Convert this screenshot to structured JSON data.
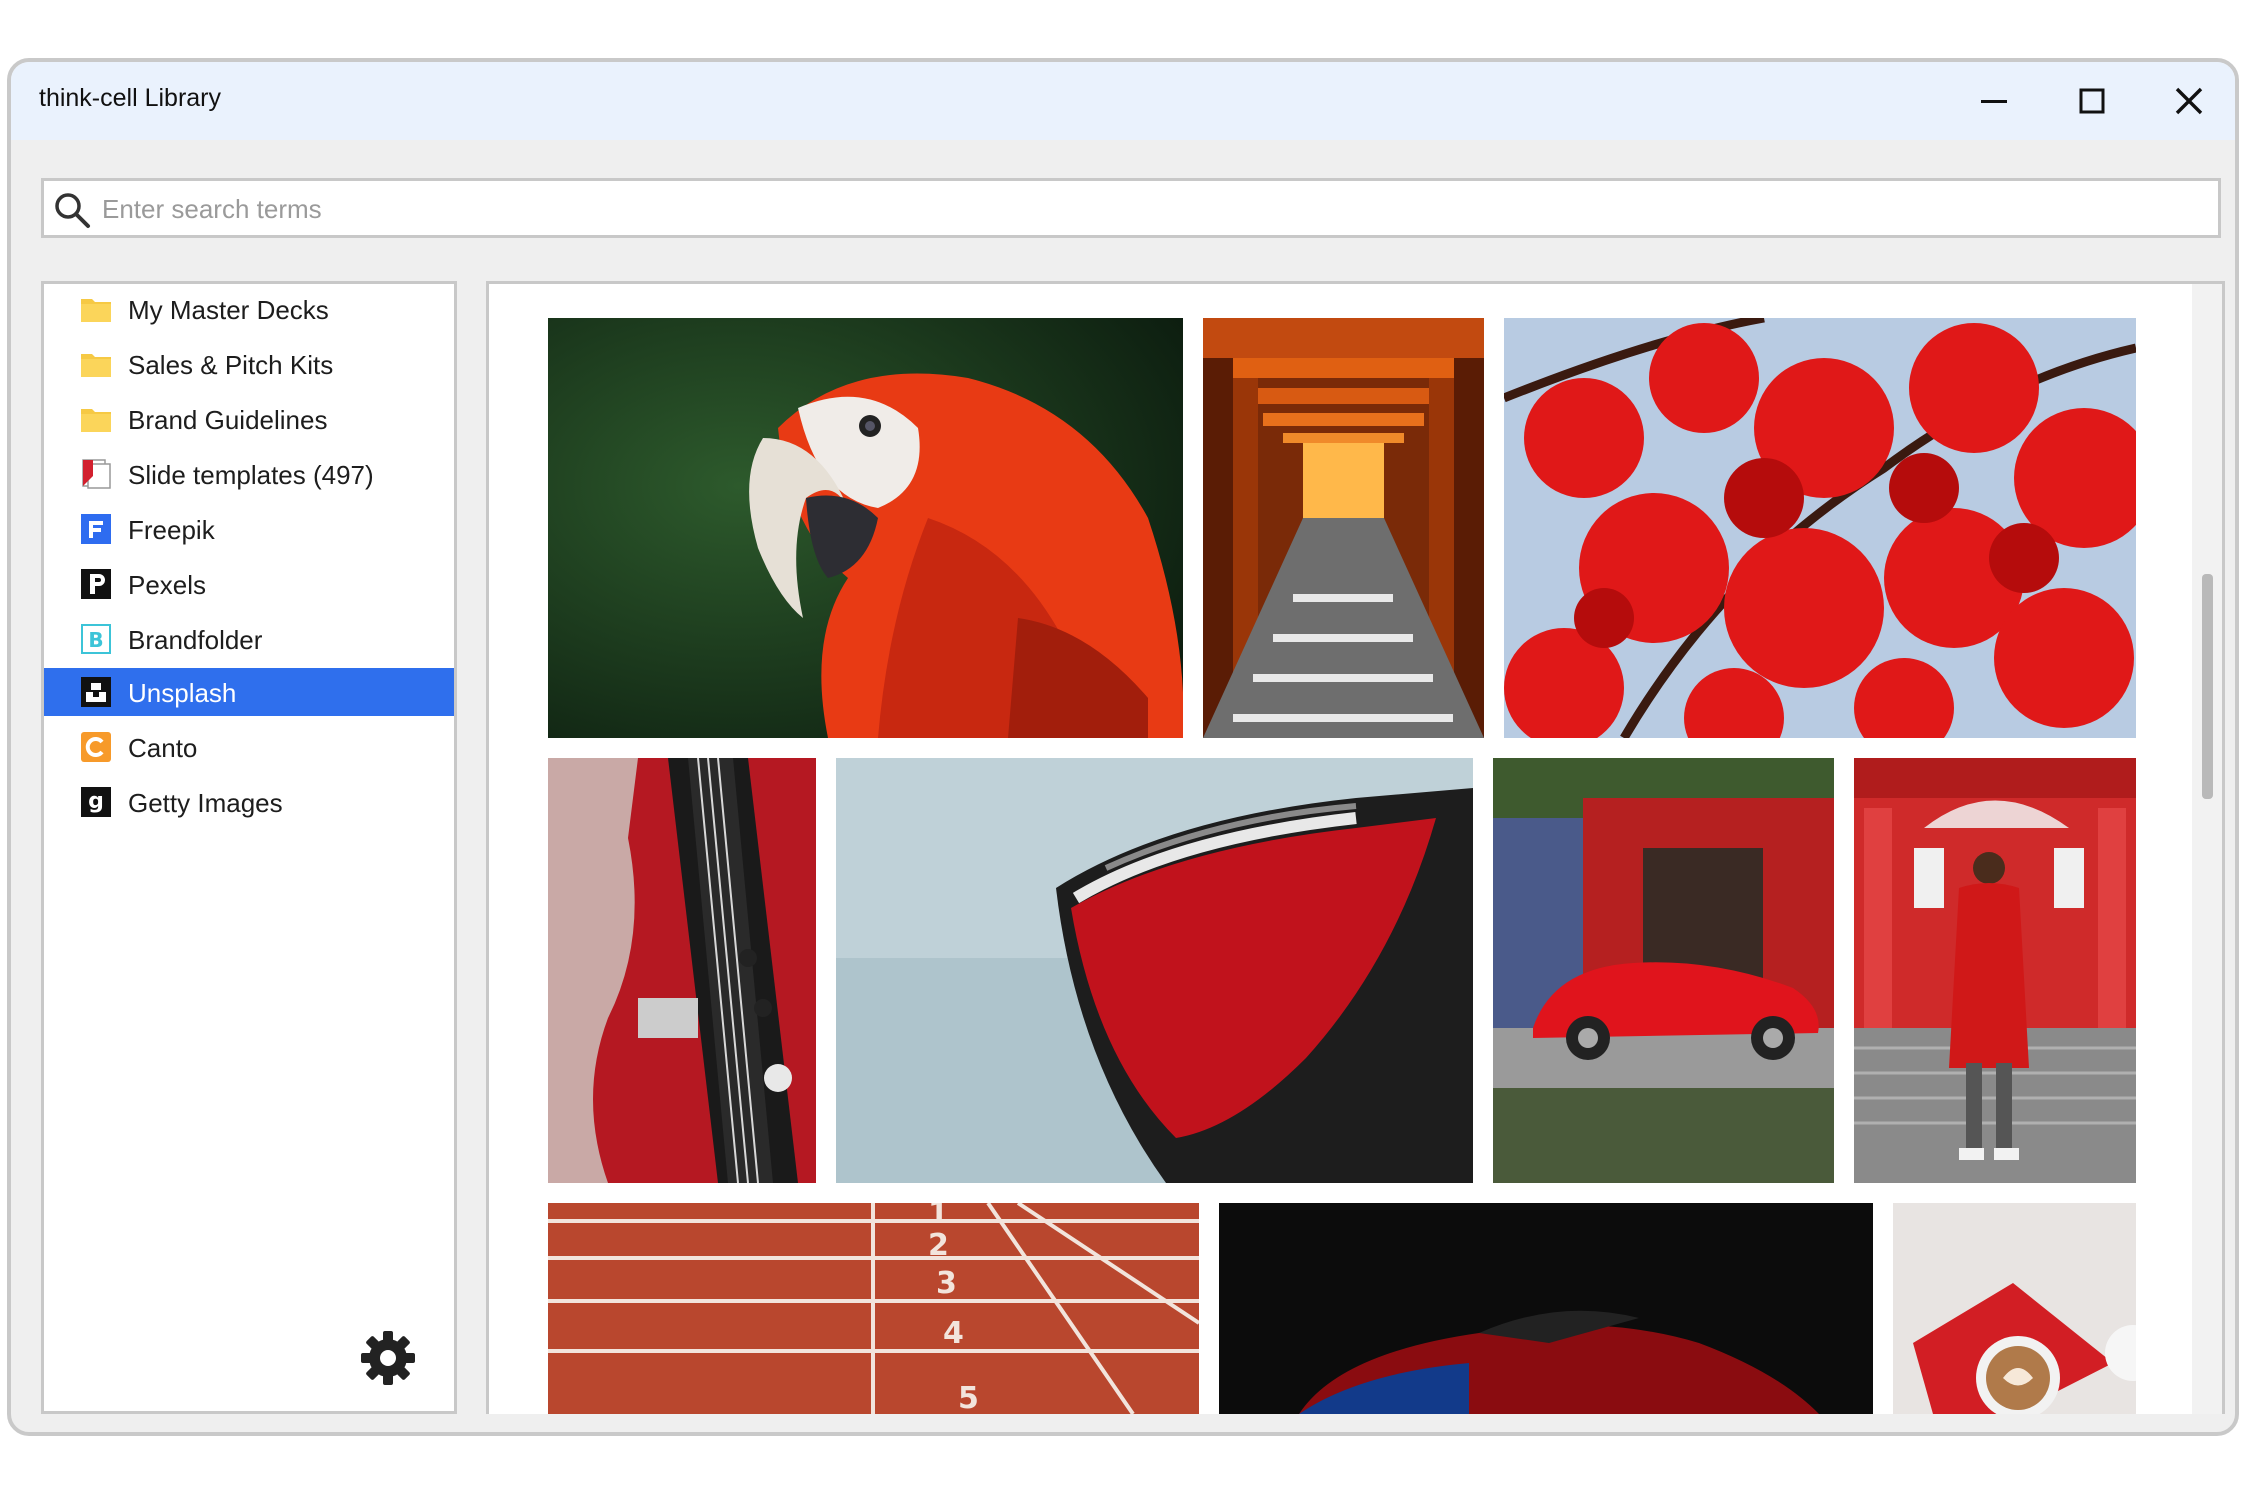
{
  "window": {
    "title": "think-cell Library",
    "minimize_icon": "minimize-icon",
    "maximize_icon": "maximize-icon",
    "close_icon": "close-icon"
  },
  "search": {
    "placeholder": "Enter search terms",
    "value": "",
    "icon": "search-icon"
  },
  "sidebar": {
    "selected_index": 7,
    "selected_color": "#2f6fed",
    "items": [
      {
        "label": "My Master Decks",
        "icon": "folder-icon"
      },
      {
        "label": "Sales & Pitch Kits",
        "icon": "folder-icon"
      },
      {
        "label": "Brand Guidelines",
        "icon": "folder-icon"
      },
      {
        "label": "Slide templates (497)",
        "icon": "slide-templates-icon"
      },
      {
        "label": "Freepik",
        "icon": "freepik-logo-icon"
      },
      {
        "label": "Pexels",
        "icon": "pexels-logo-icon"
      },
      {
        "label": "Brandfolder",
        "icon": "brandfolder-logo-icon"
      },
      {
        "label": "Unsplash",
        "icon": "unsplash-logo-icon"
      },
      {
        "label": "Canto",
        "icon": "canto-logo-icon"
      },
      {
        "label": "Getty Images",
        "icon": "getty-images-logo-icon"
      }
    ],
    "settings_icon": "gear-icon"
  },
  "gallery": {
    "images": [
      {
        "subject": "red macaw parrot"
      },
      {
        "subject": "torii gate tunnel"
      },
      {
        "subject": "red maple leaves"
      },
      {
        "subject": "red electric guitar"
      },
      {
        "subject": "red boat bow"
      },
      {
        "subject": "red convertible beetle"
      },
      {
        "subject": "woman in red coat with umbrella"
      },
      {
        "subject": "running track lanes"
      },
      {
        "subject": "red sports car at night"
      },
      {
        "subject": "red book with latte"
      }
    ]
  }
}
